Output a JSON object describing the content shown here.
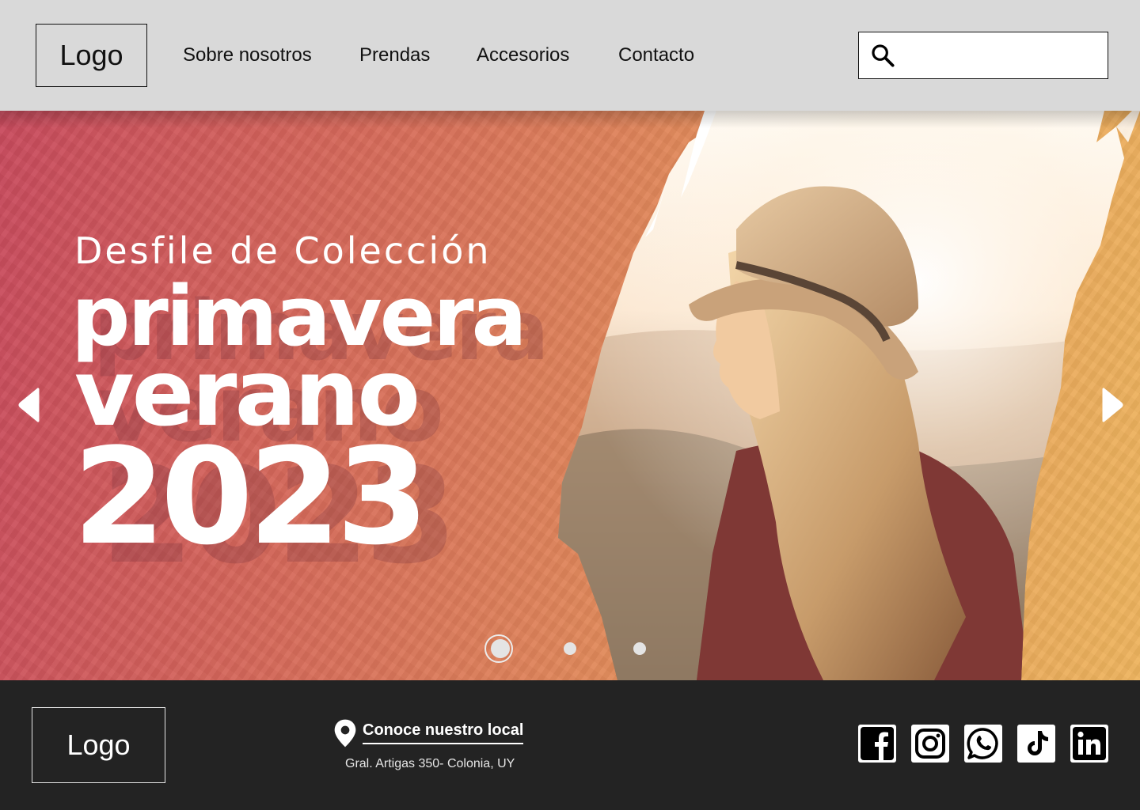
{
  "header": {
    "logo": "Logo",
    "nav": [
      {
        "label": "Sobre nosotros"
      },
      {
        "label": "Prendas"
      },
      {
        "label": "Accesorios"
      },
      {
        "label": "Contacto"
      }
    ],
    "search": {
      "placeholder": "",
      "value": "",
      "icon": "search-icon"
    }
  },
  "hero": {
    "subtitle": "Desfile de Colección",
    "line1": "primavera",
    "line2": "verano",
    "line3": "2023",
    "prev_icon": "chevron-left-icon",
    "next_icon": "chevron-right-icon",
    "slides": {
      "count": 3,
      "active": 1
    }
  },
  "footer": {
    "logo": "Logo",
    "local_link": "Conoce nuestro local",
    "address": "Gral. Artigas 350- Colonia, UY",
    "social": [
      "facebook-icon",
      "instagram-icon",
      "whatsapp-icon",
      "tiktok-icon",
      "linkedin-icon"
    ]
  },
  "colors": {
    "header_bg": "#d9d9d9",
    "footer_bg": "#232323",
    "hero_gradient_start": "#c84a5d",
    "hero_gradient_end": "#eeb45e"
  }
}
